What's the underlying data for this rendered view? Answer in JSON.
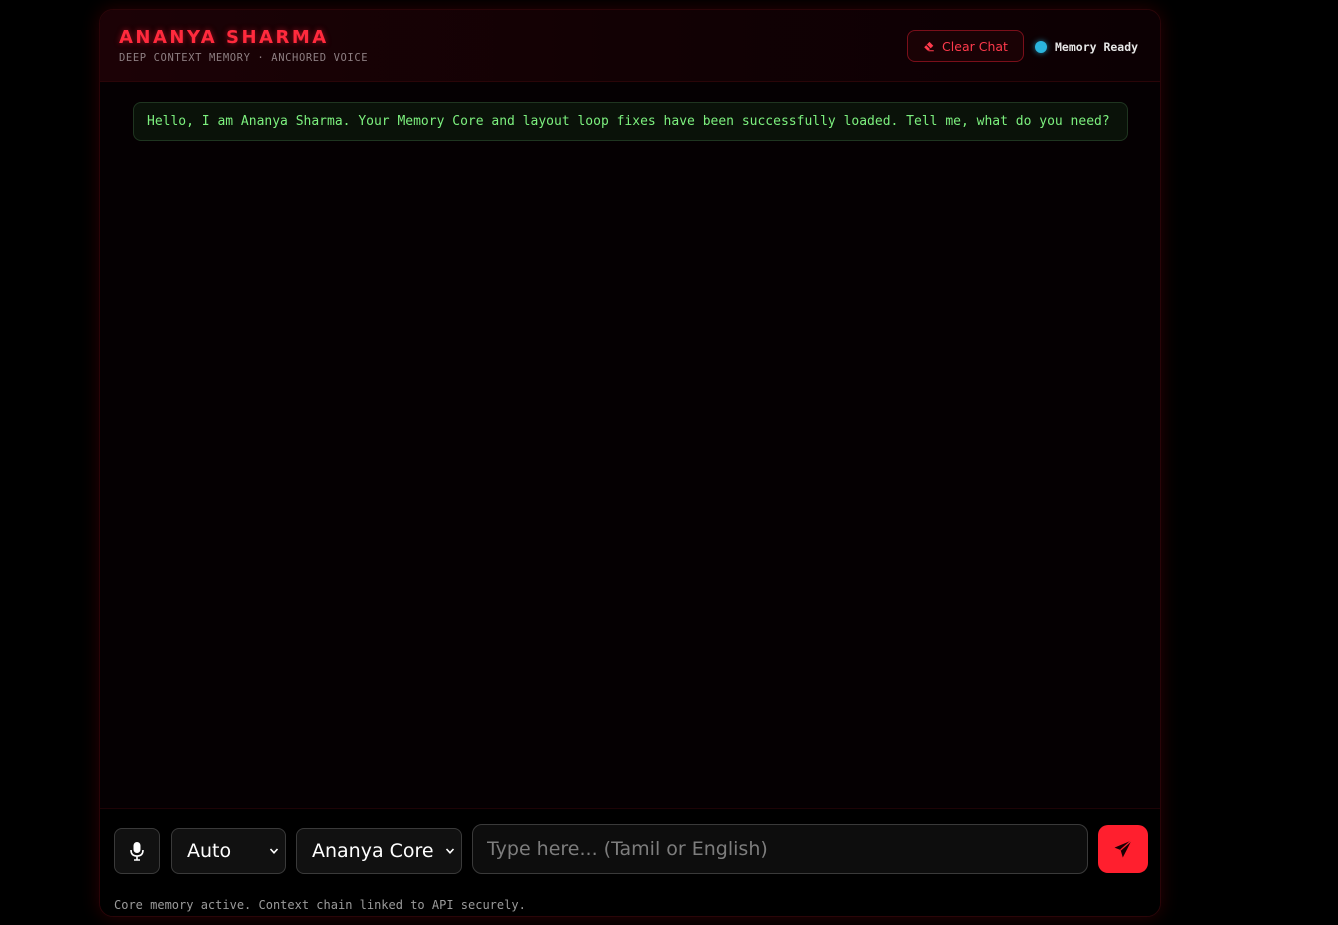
{
  "header": {
    "title": "ANANYA SHARMA",
    "subtitle": "DEEP CONTEXT MEMORY · ANCHORED VOICE",
    "clear_label": "Clear Chat",
    "status_label": "Memory Ready",
    "status_color": "#2bb4dd"
  },
  "chat": {
    "messages": [
      {
        "role": "assistant",
        "text": "Hello, I am Ananya Sharma. Your Memory Core and layout loop fixes have been successfully loaded. Tell me, what do you need?"
      }
    ]
  },
  "composer": {
    "language_mode": "Auto",
    "persona": "Ananya Core",
    "input_value": "",
    "input_placeholder": "Type here... (Tamil or English)",
    "note": "Core memory active. Context chain linked to API securely."
  },
  "icons": {
    "clear": "eraser-icon",
    "mic": "microphone-icon",
    "send": "paper-plane-icon",
    "dropdown": "chevron-down-icon"
  },
  "colors": {
    "accent": "#ff1f2e",
    "message_text": "#7cf07e",
    "background": "#000000"
  }
}
